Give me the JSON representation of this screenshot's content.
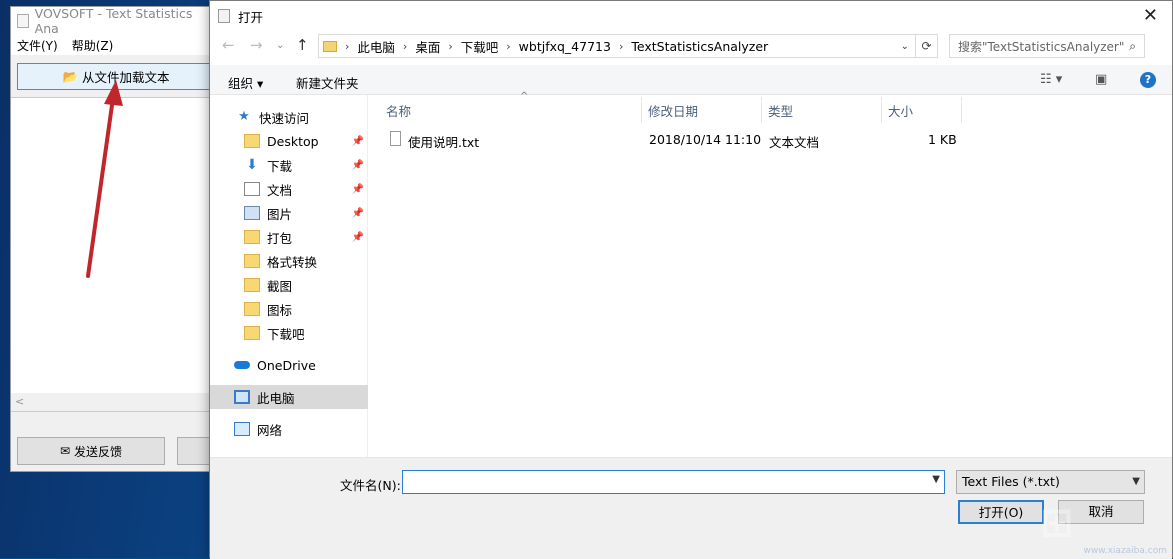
{
  "app": {
    "title": "VOVSOFT - Text Statistics Ana",
    "menu": [
      "文件(Y)",
      "帮助(Z)"
    ],
    "load_button": "从文件加载文本",
    "feedback_button": "发送反馈",
    "hscroll_arrow": "<"
  },
  "dialog": {
    "title": "打开",
    "close_glyph": "✕",
    "breadcrumbs": [
      "此电脑",
      "桌面",
      "下载吧",
      "wbtjfxq_47713",
      "TextStatisticsAnalyzer"
    ],
    "search_placeholder": "搜索\"TextStatisticsAnalyzer\"",
    "toolbar": {
      "organize": "组织 ▾",
      "new_folder": "新建文件夹"
    },
    "nav": {
      "quick_access": "快速访问",
      "items": [
        "Desktop",
        "下载",
        "文档",
        "图片",
        "打包",
        "格式转换",
        "截图",
        "图标",
        "下载吧"
      ],
      "onedrive": "OneDrive",
      "this_pc": "此电脑",
      "network": "网络"
    },
    "columns": {
      "name": "名称",
      "modified": "修改日期",
      "type": "类型",
      "size": "大小"
    },
    "files": [
      {
        "name": "使用说明.txt",
        "modified": "2018/10/14 11:10",
        "type": "文本文档",
        "size": "1 KB"
      }
    ],
    "filename_label": "文件名(N):",
    "filename_value": "",
    "filetype": "Text Files (*.txt)",
    "open_button": "打开(O)",
    "cancel_button": "取消"
  },
  "watermark": "www.xiazaiba.com",
  "colors": {
    "accent": "#2a7fd3",
    "arrow": "#c0272d"
  }
}
